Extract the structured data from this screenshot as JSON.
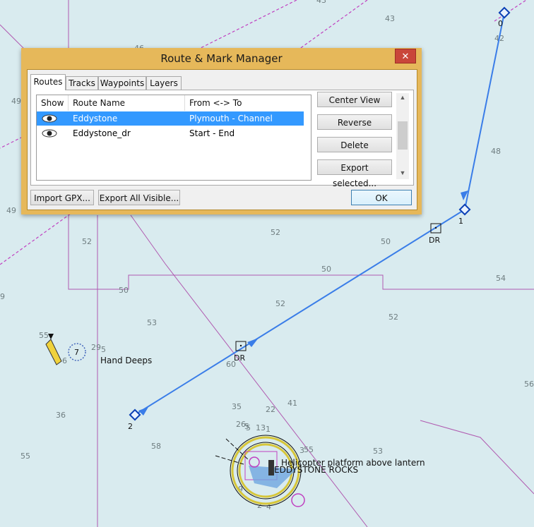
{
  "chart": {
    "soundings": [
      {
        "t": "43"
      },
      {
        "t": "43"
      },
      {
        "t": "46"
      },
      {
        "t": "42"
      },
      {
        "t": "49"
      },
      {
        "t": "48"
      },
      {
        "t": "49"
      },
      {
        "t": "52"
      },
      {
        "t": "50"
      },
      {
        "t": "52"
      },
      {
        "t": "50"
      },
      {
        "t": "54"
      },
      {
        "t": "50"
      },
      {
        "t": "52"
      },
      {
        "t": "53"
      },
      {
        "t": "52"
      },
      {
        "t": "9"
      },
      {
        "t": "55"
      },
      {
        "t": "29"
      },
      {
        "t": "5"
      },
      {
        "t": "6"
      },
      {
        "t": "60"
      },
      {
        "t": "56"
      },
      {
        "t": "36"
      },
      {
        "t": "35"
      },
      {
        "t": "22"
      },
      {
        "t": "41"
      },
      {
        "t": "26"
      },
      {
        "t": "5"
      },
      {
        "t": "13"
      },
      {
        "t": "1"
      },
      {
        "t": "55"
      },
      {
        "t": "58"
      },
      {
        "t": "55"
      },
      {
        "t": "53"
      },
      {
        "t": "9"
      },
      {
        "t": "2"
      },
      {
        "t": "3"
      },
      {
        "t": "5"
      },
      {
        "t": "4"
      }
    ],
    "waypoints": [
      {
        "label": "0"
      },
      {
        "label": "1"
      },
      {
        "label": "2"
      }
    ],
    "dr_labels": [
      {
        "label": "DR"
      },
      {
        "label": "DR"
      }
    ],
    "features": {
      "hand_deeps": "Hand Deeps",
      "buoy_number": "7",
      "helicopter": "Helicopter platform above lantern",
      "eddystone": "EDDYSTONE ROCKS"
    },
    "colors": {
      "water": "#d9ebef",
      "route": "#3a7de8",
      "contour": "#b05ab0",
      "waypoint": "#0b3fb5"
    }
  },
  "dialog": {
    "title": "Route & Mark Manager",
    "close_icon": "close-icon",
    "tabs": [
      {
        "label": "Routes",
        "active": true
      },
      {
        "label": "Tracks",
        "active": false
      },
      {
        "label": "Waypoints",
        "active": false
      },
      {
        "label": "Layers",
        "active": false
      }
    ],
    "columns": [
      "Show",
      "Route Name",
      "From <-> To"
    ],
    "rows": [
      {
        "name": "Eddystone",
        "from_to": "Plymouth - Channel",
        "selected": true,
        "icon": "eye-icon"
      },
      {
        "name": "Eddystone_dr",
        "from_to": "Start - End",
        "selected": false,
        "icon": "eye-icon"
      }
    ],
    "side_buttons": [
      "Center View",
      "Reverse",
      "Delete",
      "Export selected..."
    ],
    "import_label": "Import GPX...",
    "export_all_label": "Export All Visible...",
    "ok_label": "OK"
  }
}
